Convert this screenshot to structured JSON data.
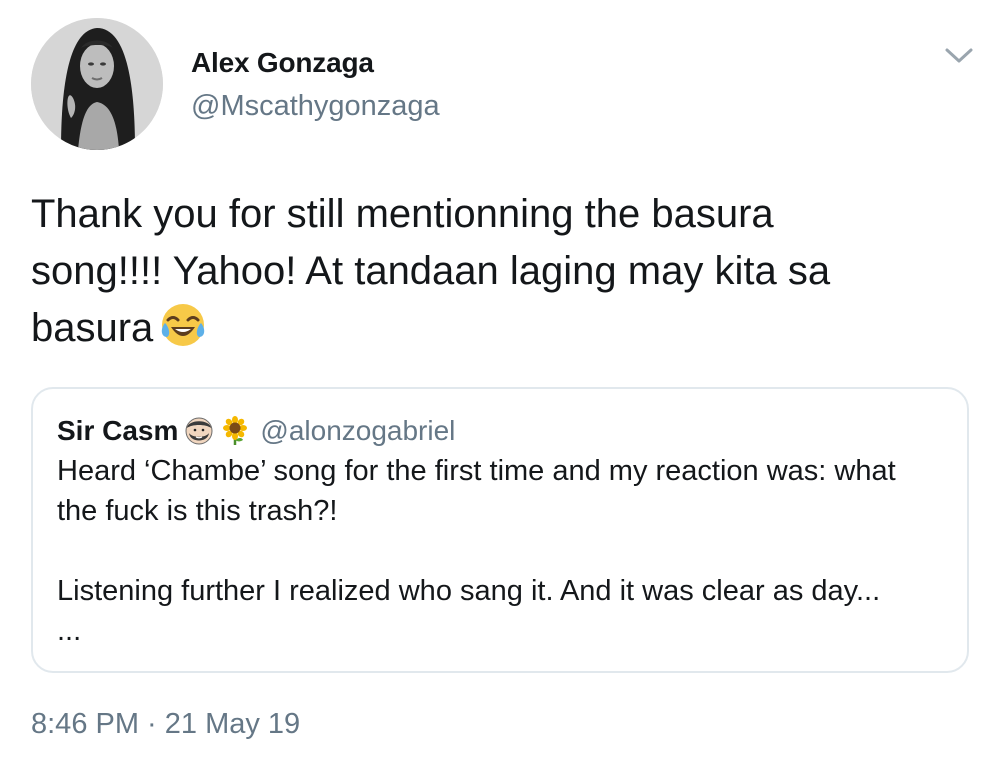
{
  "tweet": {
    "author": {
      "name": "Alex Gonzaga",
      "handle": "@Mscathygonzaga"
    },
    "text_lines": [
      "Thank you for still mentionning the basura",
      "song!!!! Yahoo! At tandaan laging may kita sa",
      "basura"
    ],
    "text_emoji": "face-with-tears-of-joy-icon",
    "menu_icon": "chevron-down-icon",
    "timestamp": "8:46 PM · 21 May 19"
  },
  "quoted_tweet": {
    "author": {
      "name": "Sir Casm",
      "handle": "@alonzogabriel",
      "emojis": [
        "man-bearded-face-icon",
        "sunflower-icon"
      ]
    },
    "lines": [
      "Heard ‘Chambe’ song for the first time and my reaction was: what",
      "the fuck is this trash?!",
      "Listening further I realized who sang it. And it was clear as day...",
      "..."
    ]
  },
  "colors": {
    "text": "#14171a",
    "secondary": "#657786",
    "border": "#e1e8ed"
  }
}
